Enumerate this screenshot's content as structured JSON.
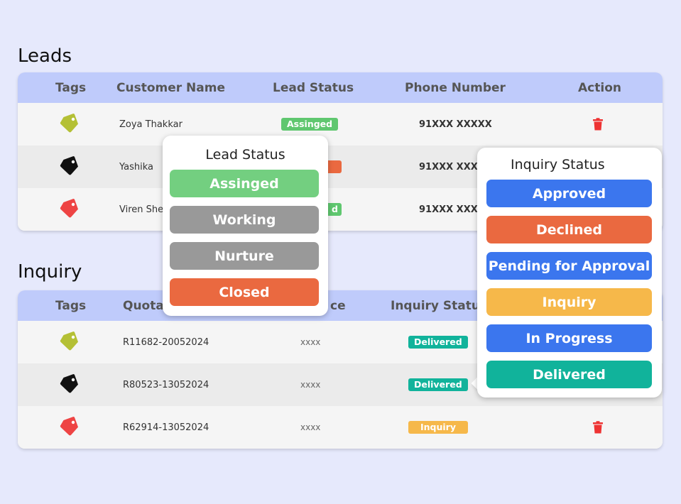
{
  "leads": {
    "title": "Leads",
    "headers": {
      "tags": "Tags",
      "customer": "Customer Name",
      "status": "Lead Status",
      "phone": "Phone Number",
      "action": "Action"
    },
    "rows": [
      {
        "tag_color": "#b4c035",
        "name": "Zoya Thakkar",
        "status": "Assinged",
        "status_color": "#5fc76f",
        "phone": "91XXX XXXXX"
      },
      {
        "tag_color": "#111111",
        "name": "Yashika",
        "status": "",
        "status_color": "#ea6940",
        "phone": "91XXX XXXX"
      },
      {
        "tag_color": "#ee4444",
        "name": "Viren She",
        "status": "d",
        "status_color": "#5fc76f",
        "phone": "91XXX XXXX"
      }
    ]
  },
  "inquiry": {
    "title": "Inquiry",
    "headers": {
      "tags": "Tags",
      "quotation": "Quota",
      "price": "ce",
      "status": "Inquiry Status"
    },
    "rows": [
      {
        "tag_color": "#b4c035",
        "quote": "R11682-20052024",
        "price": "xxxx",
        "status": "Delivered",
        "status_color": "#11b39b"
      },
      {
        "tag_color": "#111111",
        "quote": "R80523-13052024",
        "price": "xxxx",
        "status": "Delivered",
        "status_color": "#11b39b"
      },
      {
        "tag_color": "#ee4444",
        "quote": "R62914-13052024",
        "price": "xxxx",
        "status": "Inquiry",
        "status_color": "#f6b84a"
      }
    ]
  },
  "lead_status_popup": {
    "title": "Lead Status",
    "options": [
      {
        "label": "Assinged",
        "color": "#73cf80"
      },
      {
        "label": "Working",
        "color": "#999999"
      },
      {
        "label": "Nurture",
        "color": "#999999"
      },
      {
        "label": "Closed",
        "color": "#ea6940"
      }
    ]
  },
  "inquiry_status_popup": {
    "title": "Inquiry Status",
    "options": [
      {
        "label": "Approved",
        "color": "#3b76ee"
      },
      {
        "label": "Declined",
        "color": "#ea6940"
      },
      {
        "label": "Pending for Approval",
        "color": "#3b76ee"
      },
      {
        "label": "Inquiry",
        "color": "#f6b84a"
      },
      {
        "label": "In Progress",
        "color": "#3b76ee"
      },
      {
        "label": "Delivered",
        "color": "#11b39b"
      }
    ]
  },
  "colors": {
    "trash": "#ee3333",
    "header_bg": "#bfcbfb",
    "page_bg": "#e6e9fc"
  }
}
